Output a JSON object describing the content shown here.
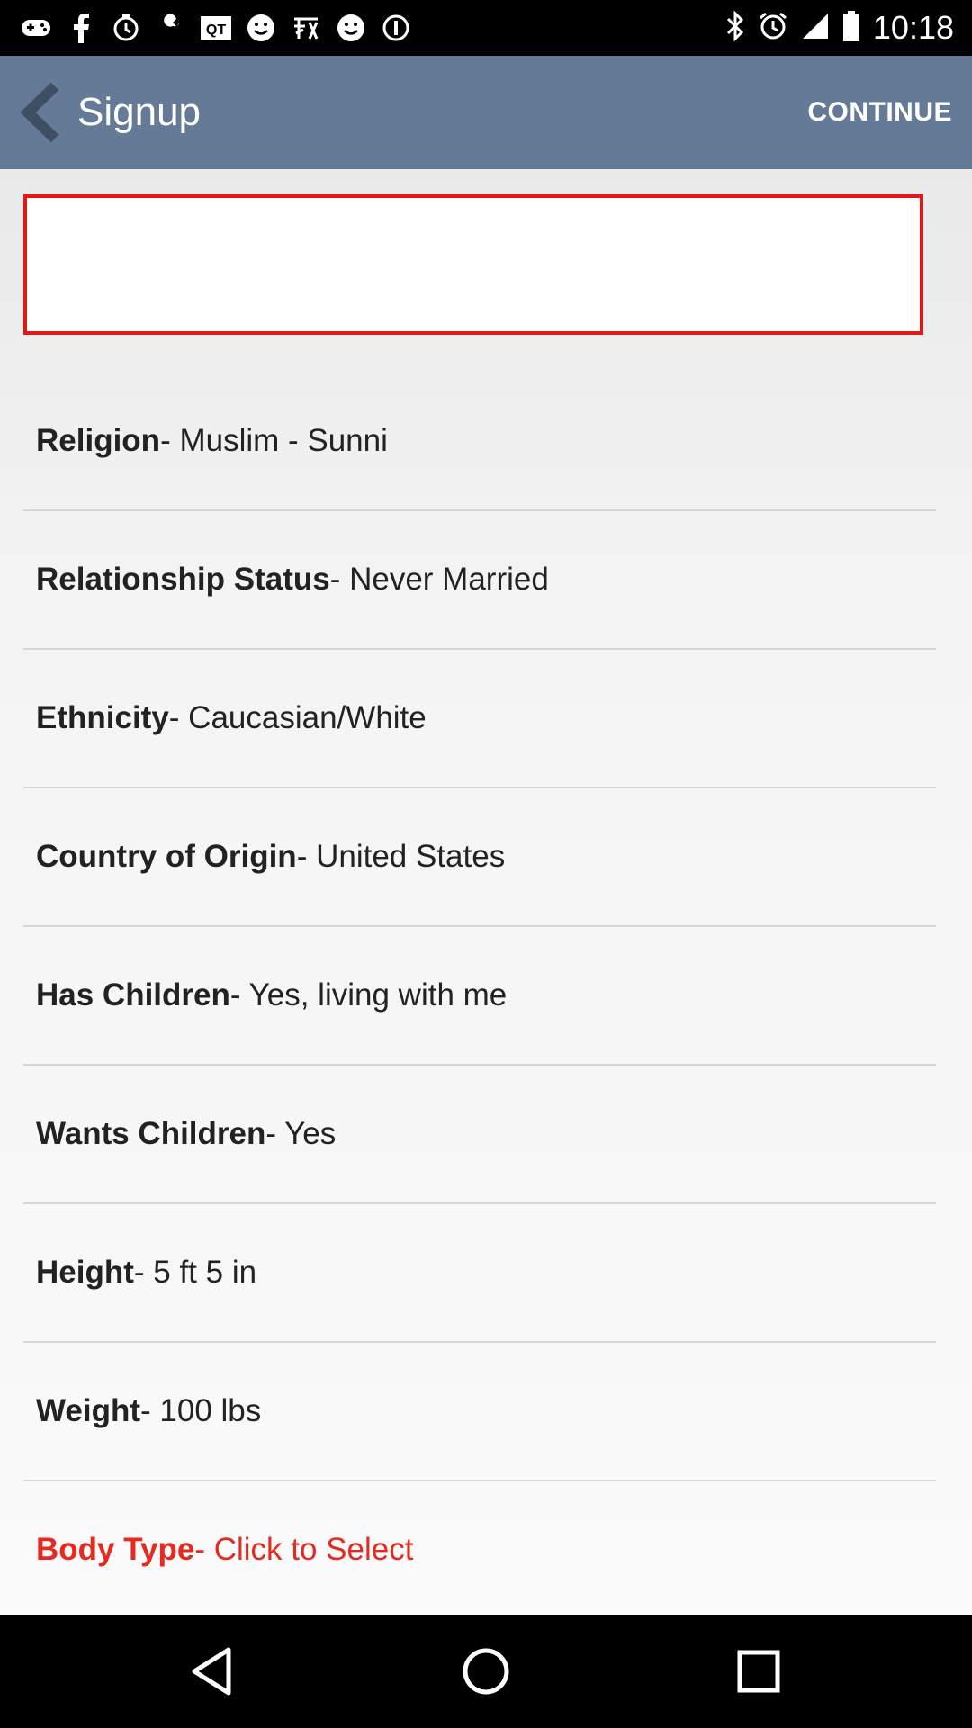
{
  "status_bar": {
    "time": "10:18",
    "left_icons": [
      "gamepad-icon",
      "facebook-icon",
      "clock-icon",
      "wrench-icon",
      "qt-icon",
      "smiley-icon",
      "chinese-char-icon",
      "smiley-icon",
      "info-icon"
    ],
    "right_icons": [
      "bluetooth-icon",
      "alarm-icon",
      "signal-icon",
      "battery-icon"
    ]
  },
  "action_bar": {
    "title": "Signup",
    "continue_label": "CONTINUE",
    "bg_color": "#647a96"
  },
  "input": {
    "value": "",
    "border_color": "#e01818"
  },
  "rows": [
    {
      "label": "Religion",
      "value": " - Muslim - Sunni"
    },
    {
      "label": "Relationship Status",
      "value": " - Never Married"
    },
    {
      "label": "Ethnicity",
      "value": " - Caucasian/White"
    },
    {
      "label": "Country of Origin",
      "value": " - United States"
    },
    {
      "label": "Has Children",
      "value": " - Yes, living with me"
    },
    {
      "label": "Wants Children",
      "value": " - Yes"
    },
    {
      "label": "Height",
      "value": " - 5 ft 5 in"
    },
    {
      "label": "Weight",
      "value": " - 100 lbs"
    },
    {
      "label": "Body Type",
      "value": " - Click to Select",
      "color": "#e52a20"
    }
  ],
  "nav_bar": {
    "buttons": [
      "back-icon",
      "home-icon",
      "recents-icon"
    ]
  }
}
